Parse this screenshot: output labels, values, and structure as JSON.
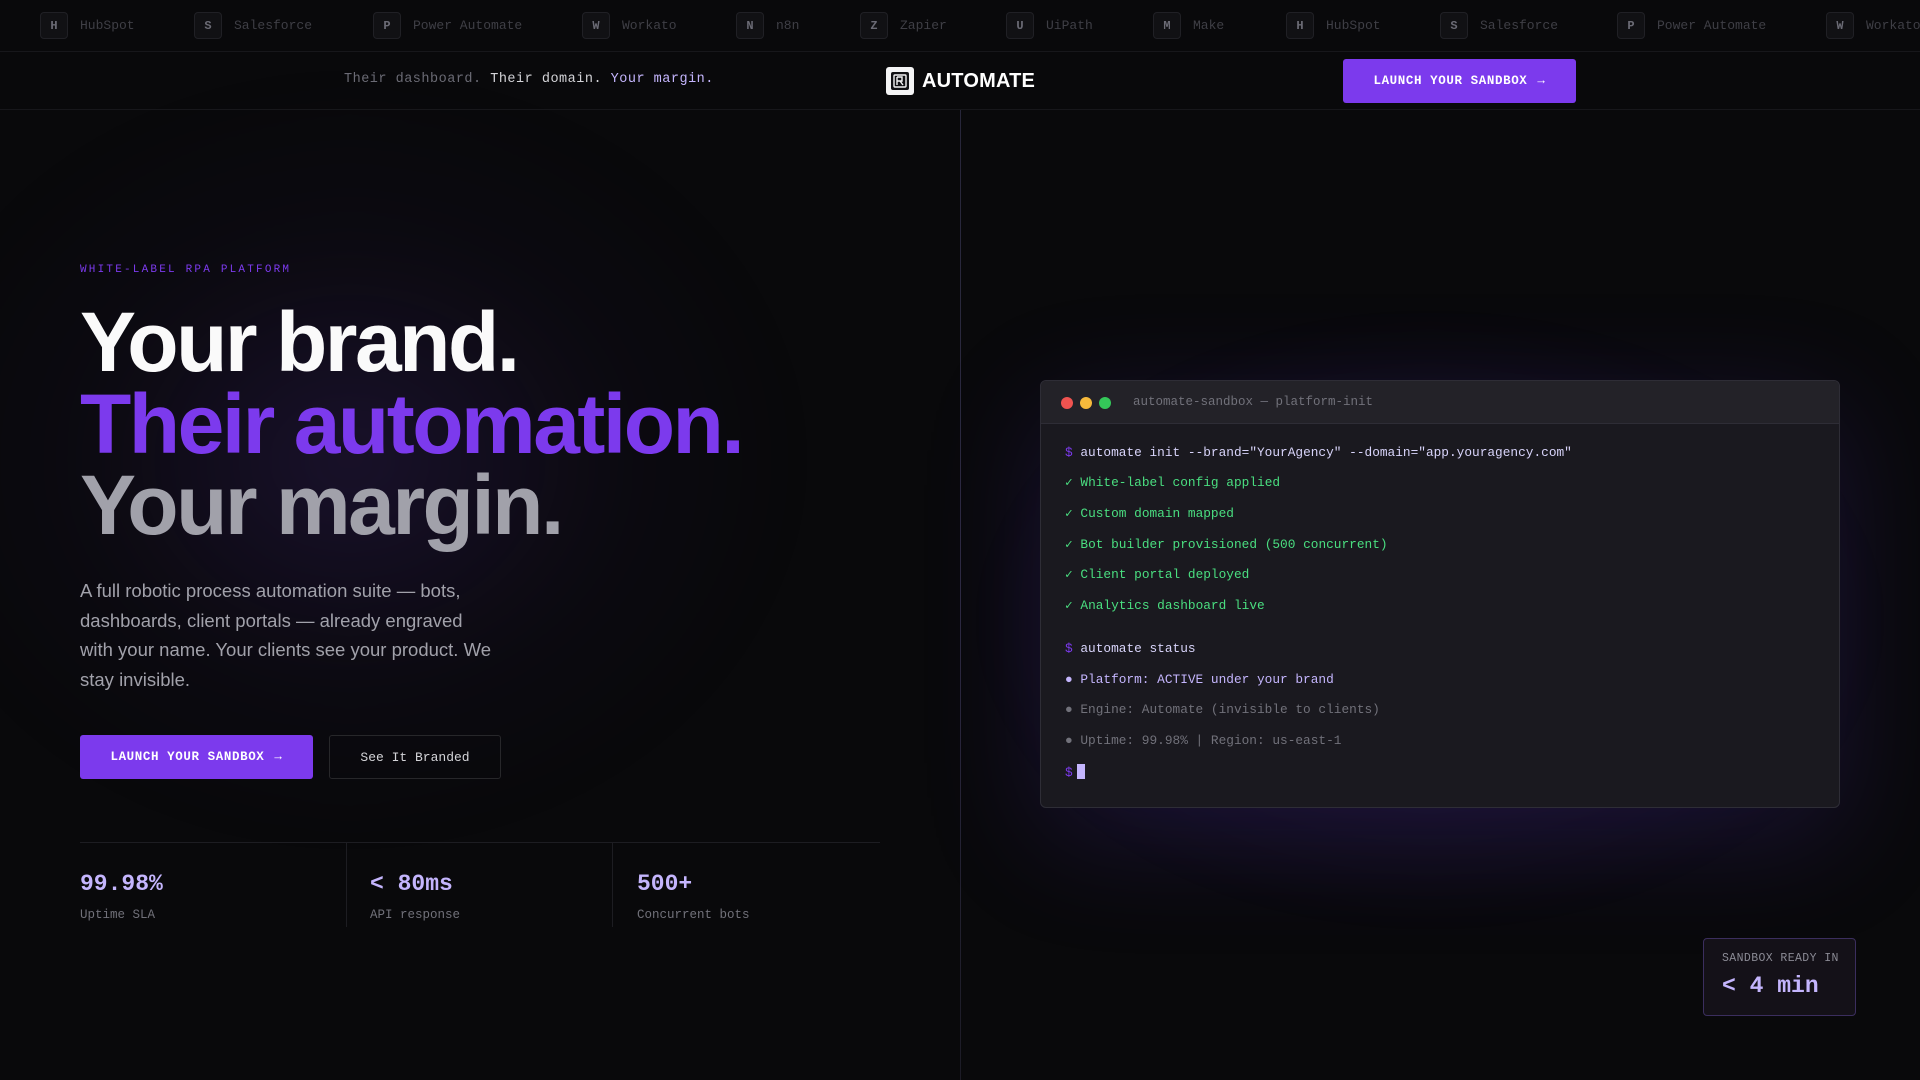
{
  "ticker": [
    {
      "letter": "H",
      "name": "HubSpot"
    },
    {
      "letter": "S",
      "name": "Salesforce"
    },
    {
      "letter": "P",
      "name": "Power Automate"
    },
    {
      "letter": "W",
      "name": "Workato"
    },
    {
      "letter": "N",
      "name": "n8n"
    },
    {
      "letter": "Z",
      "name": "Zapier"
    },
    {
      "letter": "U",
      "name": "UiPath"
    },
    {
      "letter": "M",
      "name": "Make"
    },
    {
      "letter": "H",
      "name": "HubSpot"
    },
    {
      "letter": "S",
      "name": "Salesforce"
    },
    {
      "letter": "P",
      "name": "Power Automate"
    },
    {
      "letter": "W",
      "name": "Workato"
    }
  ],
  "header": {
    "tagline_1": "Their dashboard.",
    "tagline_2": "Their domain.",
    "tagline_3": "Your margin.",
    "logo_text": "AUTOMATE",
    "cta_label": "LAUNCH YOUR SANDBOX",
    "cta_arrow": "→"
  },
  "hero": {
    "eyebrow": "WHITE-LABEL RPA PLATFORM",
    "headline_1": "Your brand.",
    "headline_2": "Their automation.",
    "headline_3": "Your margin.",
    "description": "A full robotic process automation suite — bots, dashboards, client portals — already engraved with your name. Your clients see your product. We stay invisible.",
    "primary_cta": "LAUNCH YOUR SANDBOX",
    "primary_arrow": "→",
    "secondary_cta": "See It Branded"
  },
  "stats": [
    {
      "value": "99.98%",
      "label": "Uptime SLA"
    },
    {
      "value": "< 80ms",
      "label": "API response"
    },
    {
      "value": "500+",
      "label": "Concurrent bots"
    }
  ],
  "terminal": {
    "title": "automate-sandbox — platform-init",
    "prompt": "$",
    "cmd_init": "automate init --brand=\"YourAgency\" --domain=\"app.youragency.com\"",
    "ok_lines": [
      "✓ White-label config applied",
      "✓ Custom domain mapped",
      "✓ Bot builder provisioned (500 concurrent)",
      "✓ Client portal deployed",
      "✓ Analytics dashboard live"
    ],
    "cmd_status": "automate status",
    "status_active": "● Platform: ACTIVE under your brand",
    "status_engine": "● Engine: Automate (invisible to clients)",
    "status_uptime": "● Uptime: 99.98% | Region: us-east-1"
  },
  "sandbox_ready": {
    "label": "SANDBOX READY IN",
    "value": "< 4 min"
  },
  "colors": {
    "accent": "#7c3aed",
    "accent_light": "#c4b5fd",
    "success": "#4ade80",
    "background": "#09090b"
  }
}
